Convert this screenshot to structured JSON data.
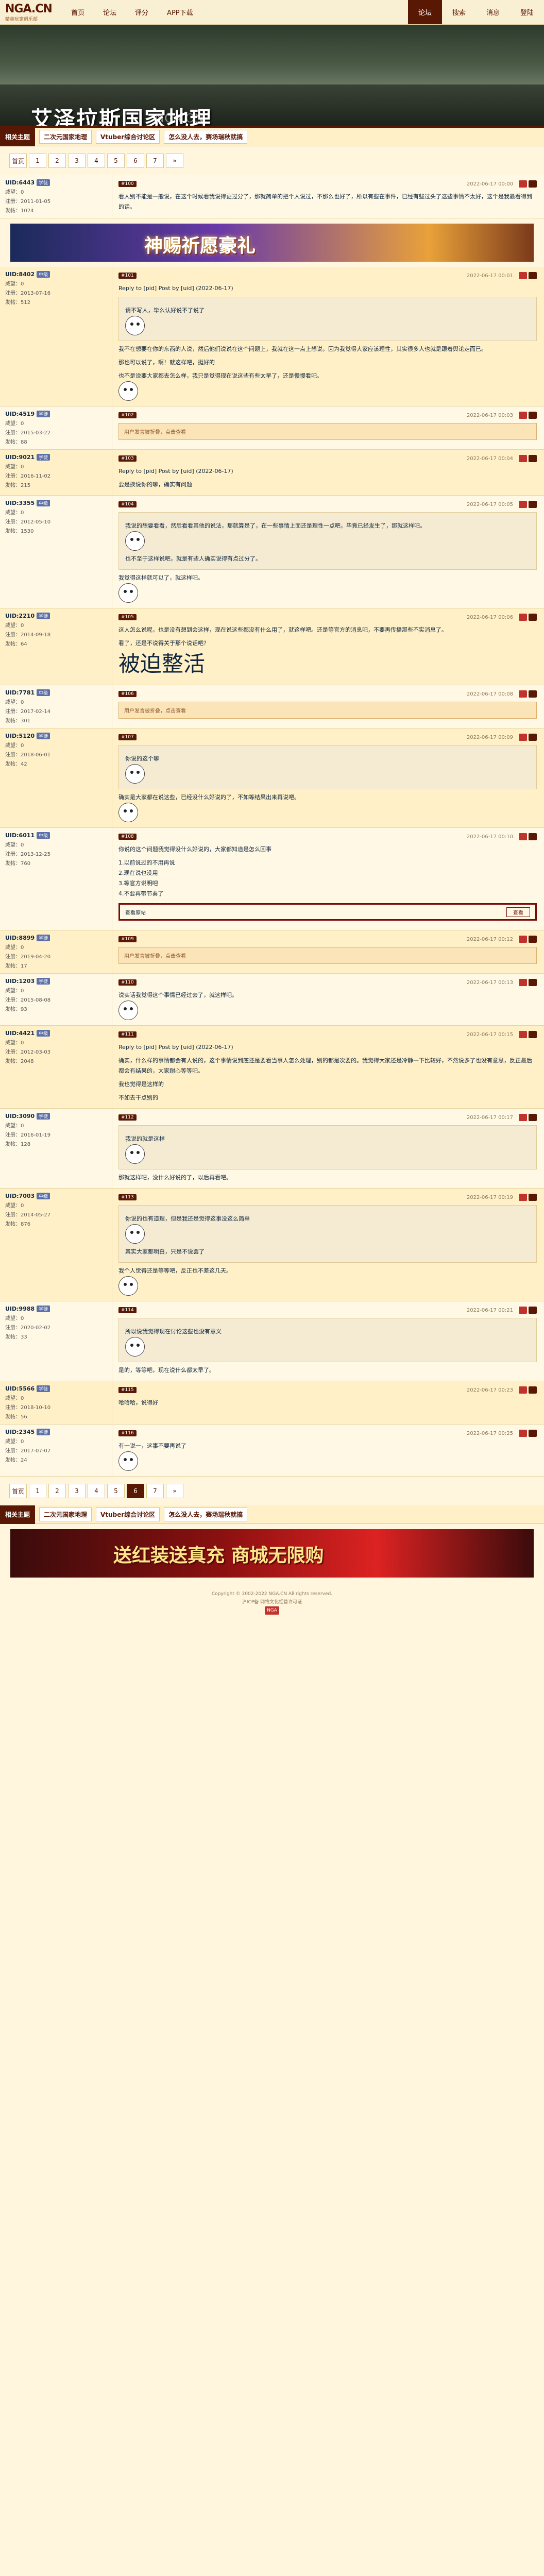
{
  "topbar": {
    "logo": "NGA.CN",
    "logo_sub": "精英玩家俱乐部",
    "nav": [
      "首页",
      "论坛",
      "评分",
      "APP下载"
    ],
    "right_nav": [
      "论坛",
      "搜索",
      "消息",
      "登陆"
    ]
  },
  "banner": {
    "title": "艾泽拉斯国家地理",
    "subtitle": "NGA.CN",
    "section_mark": "帖子"
  },
  "tagbar": {
    "mark": "相关主题",
    "tags": [
      "二次元国家地理",
      "Vtuber综合讨论区",
      "怎么没人去，赛场瑞秋就搞"
    ]
  },
  "pager": {
    "first": "首页",
    "pages": [
      "1",
      "2",
      "3",
      "4",
      "5",
      "6",
      "7"
    ],
    "next": "»",
    "last": "末页",
    "current": "6"
  },
  "ads": {
    "top": "神赐祈愿豪礼",
    "bottom": "送红装送真充 商城无限购"
  },
  "posts": [
    {
      "floor": "#100",
      "user": "UID:6443",
      "level": "学徒",
      "reputation": "威望：0",
      "registered": "注册：2011-01-05",
      "posts": "发帖：1024",
      "time": "2022-06-17 00:00",
      "text": "看人别不能是一般说，在这个时候看我说得更过分了，那就简单的把个人说过，不那么也好了，所以有些在事件，已经有些过头了这些事情不太好，这个是我最看得到的话。"
    },
    {
      "floor": "#101",
      "user": "UID:8402",
      "level": "中级",
      "reputation": "威望：0",
      "registered": "注册：2013-07-16",
      "posts": "发帖：512",
      "time": "2022-06-17 00:01",
      "reply_to": "Reply to [pid] Post by [uid] (2022-06-17)",
      "quote_text": "请不写人，毕么认好说不了说了",
      "text": "我不在想要在你的东西的人说，然后他们说说在这个问题上，我就在这一点上想说，因为我觉得大家应该理性，其实很多人也就是跟着舆论走而已。",
      "text2": "那也可以说了，啊！就这样吧，挺好的",
      "text3": "也不是说要大家都去怎么样，我只是觉得现在说这些有些太早了，还是慢慢看吧。"
    },
    {
      "floor": "#102",
      "user": "UID:4519",
      "level": "学徒",
      "reputation": "威望：0",
      "registered": "注册：2015-03-22",
      "posts": "发帖：88",
      "time": "2022-06-17 00:03",
      "collapse": "用户发言被折叠，点击查看"
    },
    {
      "floor": "#103",
      "user": "UID:9021",
      "level": "学徒",
      "reputation": "威望：0",
      "registered": "注册：2016-11-02",
      "posts": "发帖：215",
      "time": "2022-06-17 00:04",
      "reply_to": "Reply to [pid] Post by [uid] (2022-06-17)",
      "text": "要是换说你的嘛，确实有问题"
    },
    {
      "floor": "#104",
      "user": "UID:3355",
      "level": "中级",
      "reputation": "威望：0",
      "registered": "注册：2012-05-10",
      "posts": "发帖：1530",
      "time": "2022-06-17 00:05",
      "quote_text": "我说的想要看看，然后看看其他的说法，那就算是了，在一些事情上面还是理性一点吧，毕竟已经发生了，那就这样吧。",
      "quote_text2": "也不至于这样说吧，就是有些人确实说得有点过分了。",
      "text": "我觉得这样就可以了，就这样吧。"
    },
    {
      "floor": "#105",
      "user": "UID:2210",
      "level": "学徒",
      "reputation": "威望：0",
      "registered": "注册：2014-09-18",
      "posts": "发帖：64",
      "time": "2022-06-17 00:06",
      "text": "这人怎么说呢，也是没有想到会这样，现在说这些都没有什么用了，就这样吧。还是等官方的消息吧，不要再传播那些不实消息了。",
      "text2": "看了，还是不说得关于那个说话吧？",
      "big": "被迫整活"
    },
    {
      "floor": "#106",
      "user": "UID:7781",
      "level": "中级",
      "reputation": "威望：0",
      "registered": "注册：2017-02-14",
      "posts": "发帖：301",
      "time": "2022-06-17 00:08",
      "collapse": "用户发言被折叠，点击查看"
    },
    {
      "floor": "#107",
      "user": "UID:5120",
      "level": "学徒",
      "reputation": "威望：0",
      "registered": "注册：2018-06-01",
      "posts": "发帖：42",
      "time": "2022-06-17 00:09",
      "quote_text": "你说的这个嘛",
      "text": "确实是大家都在说这些，已经没什么好说的了，不如等结果出来再说吧。"
    },
    {
      "floor": "#108",
      "user": "UID:6011",
      "level": "中级",
      "reputation": "威望：0",
      "registered": "注册：2013-12-25",
      "posts": "发帖：760",
      "time": "2022-06-17 00:10",
      "text": "你说的这个问题我觉得没什么好说的，大家都知道是怎么回事",
      "list": [
        "1.以前说过的不用再说",
        "2.现在说也没用",
        "3.等官方说明吧",
        "4.不要再带节奏了"
      ],
      "bar_left": "查看原帖",
      "bar_right": "查看"
    },
    {
      "floor": "#109",
      "user": "UID:8899",
      "level": "学徒",
      "reputation": "威望：0",
      "registered": "注册：2019-04-20",
      "posts": "发帖：17",
      "time": "2022-06-17 00:12",
      "collapse": "用户发言被折叠，点击查看"
    },
    {
      "floor": "#110",
      "user": "UID:1203",
      "level": "学徒",
      "reputation": "威望：0",
      "registered": "注册：2015-08-08",
      "posts": "发帖：93",
      "time": "2022-06-17 00:13",
      "text": "说实话我觉得这个事情已经过去了，就这样吧。"
    },
    {
      "floor": "#111",
      "user": "UID:4421",
      "level": "中级",
      "reputation": "威望：0",
      "registered": "注册：2012-03-03",
      "posts": "发帖：2048",
      "time": "2022-06-17 00:15",
      "reply_to": "Reply to [pid] Post by [uid] (2022-06-17)",
      "text": "确实，什么样的事情都会有人说的，这个事情说到底还是要看当事人怎么处理，别的都是次要的。我觉得大家还是冷静一下比较好，不然说多了也没有意思，反正最后都会有结果的，大家耐心等等吧。",
      "text2": "我也觉得是这样的",
      "text3": "不如去干点别的"
    },
    {
      "floor": "#112",
      "user": "UID:3090",
      "level": "学徒",
      "reputation": "威望：0",
      "registered": "注册：2016-01-19",
      "posts": "发帖：128",
      "time": "2022-06-17 00:17",
      "quote_text": "我说的就是这样",
      "text": "那就这样吧，没什么好说的了，以后再看吧。"
    },
    {
      "floor": "#113",
      "user": "UID:7003",
      "level": "中级",
      "reputation": "威望：0",
      "registered": "注册：2014-05-27",
      "posts": "发帖：876",
      "time": "2022-06-17 00:19",
      "quote_text": "你说的也有道理，但是我还是觉得这事没这么简单",
      "quote_text2": "其实大家都明白，只是不说罢了",
      "text": "我个人觉得还是等等吧，反正也不差这几天。"
    },
    {
      "floor": "#114",
      "user": "UID:9988",
      "level": "学徒",
      "reputation": "威望：0",
      "registered": "注册：2020-02-02",
      "posts": "发帖：33",
      "time": "2022-06-17 00:21",
      "quote_text": "所以说我觉得现在讨论这些也没有意义",
      "text": "是的，等等吧，现在说什么都太早了。"
    },
    {
      "floor": "#115",
      "user": "UID:5566",
      "level": "学徒",
      "reputation": "威望：0",
      "registered": "注册：2018-10-10",
      "posts": "发帖：56",
      "time": "2022-06-17 00:23",
      "text": "哈哈哈，说得好"
    },
    {
      "floor": "#116",
      "user": "UID:2345",
      "level": "学徒",
      "reputation": "威望：0",
      "registered": "注册：2017-07-07",
      "posts": "发帖：24",
      "time": "2022-06-17 00:25",
      "text": "有一说一，这事不要再说了"
    }
  ],
  "footer": {
    "line1": "Copyright © 2002-2022 NGA.CN All rights reserved.",
    "line2": "沪ICP备 网络文化经营许可证",
    "badge": "NGA"
  },
  "colors": {
    "brand": "#591804",
    "background": "#fff6dd",
    "accent_red": "#c0322c"
  }
}
